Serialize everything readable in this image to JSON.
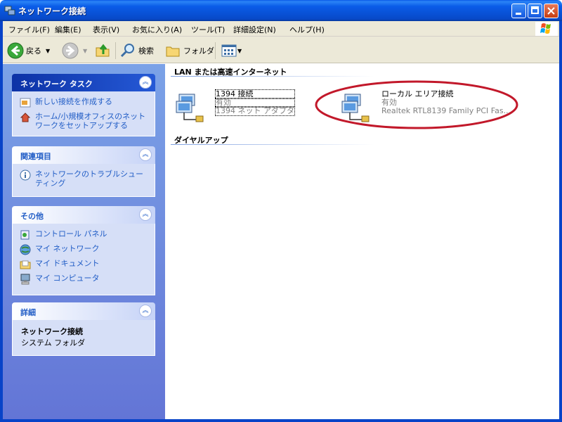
{
  "window": {
    "title": "ネットワーク接続",
    "accent": "#0a5ce8"
  },
  "menu": {
    "items": [
      "ファイル(F)",
      "編集(E)",
      "表示(V)",
      "お気に入り(A)",
      "ツール(T)",
      "詳細設定(N)",
      "ヘルプ(H)"
    ]
  },
  "toolbar": {
    "back_label": "戻る",
    "search_label": "検索",
    "folder_label": "フォルダ"
  },
  "sidebar": {
    "tasks": {
      "title": "ネットワーク タスク",
      "links": [
        "新しい接続を作成する",
        "ホーム/小規模オフィスのネットワークをセットアップする"
      ]
    },
    "related": {
      "title": "関連項目",
      "links": [
        "ネットワークのトラブルシューティング"
      ]
    },
    "other": {
      "title": "その他",
      "links": [
        "コントロール パネル",
        "マイ ネットワーク",
        "マイ ドキュメント",
        "マイ コンピュータ"
      ]
    },
    "details": {
      "title": "詳細",
      "name": "ネットワーク接続",
      "type": "システム フォルダ"
    }
  },
  "main": {
    "group_lan": "LAN または高速インターネット",
    "group_dialup": "ダイヤルアップ",
    "connections": [
      {
        "name": "1394 接続",
        "status": "有効",
        "device": "1394 ネット アダプタ"
      },
      {
        "name": "ローカル エリア接続",
        "status": "有効",
        "device": "Realtek RTL8139 Family PCI Fas..."
      }
    ]
  }
}
